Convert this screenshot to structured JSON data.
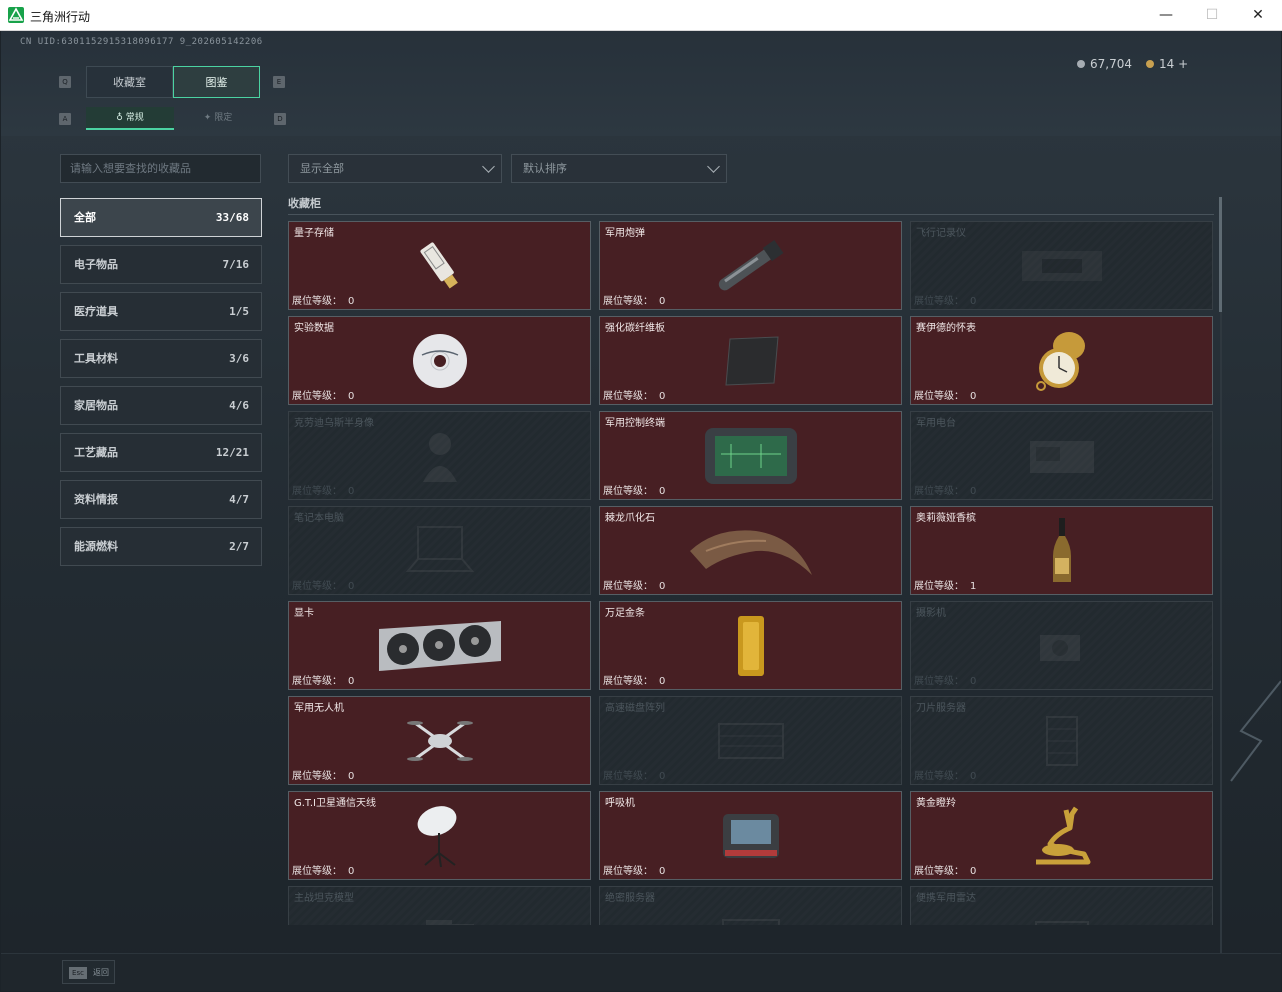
{
  "window": {
    "title": "三角洲行动",
    "minimize": "—",
    "maximize": "☐",
    "close": "✕"
  },
  "header": {
    "uid": "CN UID:6301152915318096177 9_20260514220​6",
    "currency": {
      "silver": "67,704",
      "gold": "14",
      "add": "+"
    },
    "keys": {
      "tab_left": "Q",
      "tab_right": "E",
      "sub_left": "A",
      "sub_right": "D"
    }
  },
  "tabs": [
    {
      "label": "收藏室"
    },
    {
      "label": "图鉴"
    }
  ],
  "subtabs": [
    {
      "label": "常规"
    },
    {
      "label": "限定"
    }
  ],
  "search": {
    "placeholder": "请输入想要查找的收藏品"
  },
  "filters": {
    "display": "显示全部",
    "sort": "默认排序"
  },
  "categories": [
    {
      "label": "全部",
      "count": "33/68"
    },
    {
      "label": "电子物品",
      "count": "7/16"
    },
    {
      "label": "医疗道具",
      "count": "1/5"
    },
    {
      "label": "工具材料",
      "count": "3/6"
    },
    {
      "label": "家居物品",
      "count": "4/6"
    },
    {
      "label": "工艺藏品",
      "count": "12/21"
    },
    {
      "label": "资料情报",
      "count": "4/7"
    },
    {
      "label": "能源燃料",
      "count": "2/7"
    }
  ],
  "section": {
    "title": "收藏柜",
    "level_label": "展位等级："
  },
  "items": [
    {
      "name": "量子存储",
      "level": "0",
      "icon": "usb-drive-icon"
    },
    {
      "name": "军用炮弹",
      "level": "0",
      "icon": "artillery-shell-icon"
    },
    {
      "name": "飞行记录仪",
      "level": "0",
      "icon": "flight-recorder-icon"
    },
    {
      "name": "实验数据",
      "level": "0",
      "icon": "disc-icon"
    },
    {
      "name": "强化碳纤维板",
      "level": "0",
      "icon": "carbon-plate-icon"
    },
    {
      "name": "赛伊德的怀表",
      "level": "0",
      "icon": "pocket-watch-icon"
    },
    {
      "name": "克劳迪乌斯半身像",
      "level": "0",
      "icon": "bust-icon"
    },
    {
      "name": "军用控制终端",
      "level": "0",
      "icon": "control-terminal-icon"
    },
    {
      "name": "军用电台",
      "level": "0",
      "icon": "radio-icon"
    },
    {
      "name": "笔记本电脑",
      "level": "0",
      "icon": "laptop-icon"
    },
    {
      "name": "棘龙爪化石",
      "level": "0",
      "icon": "claw-fossil-icon"
    },
    {
      "name": "奥莉薇娅香槟",
      "level": "1",
      "icon": "champagne-icon"
    },
    {
      "name": "显卡",
      "level": "0",
      "icon": "graphics-card-icon"
    },
    {
      "name": "万足金条",
      "level": "0",
      "icon": "gold-bar-icon"
    },
    {
      "name": "摄影机",
      "level": "0",
      "icon": "camera-icon"
    },
    {
      "name": "军用无人机",
      "level": "0",
      "icon": "drone-icon"
    },
    {
      "name": "高速磁盘阵列",
      "level": "0",
      "icon": "disk-array-icon"
    },
    {
      "name": "刀片服务器",
      "level": "0",
      "icon": "blade-server-icon"
    },
    {
      "name": "G.T.I卫星通信天线",
      "level": "0",
      "icon": "satellite-dish-icon"
    },
    {
      "name": "呼吸机",
      "level": "0",
      "icon": "ventilator-icon"
    },
    {
      "name": "黄金瞪羚",
      "level": "0",
      "icon": "golden-gazelle-icon"
    },
    {
      "name": "主战坦克模型",
      "level": "",
      "icon": "tank-model-icon"
    },
    {
      "name": "绝密服务器",
      "level": "",
      "icon": "server-icon"
    },
    {
      "name": "便携军用雷达",
      "level": "",
      "icon": "radar-icon"
    }
  ],
  "footer": {
    "esc_key": "Esc",
    "esc_label": "返回"
  },
  "colors": {
    "accent": "#4bd3a2",
    "owned_card": "#471f23",
    "locked_card": "#252c32"
  }
}
